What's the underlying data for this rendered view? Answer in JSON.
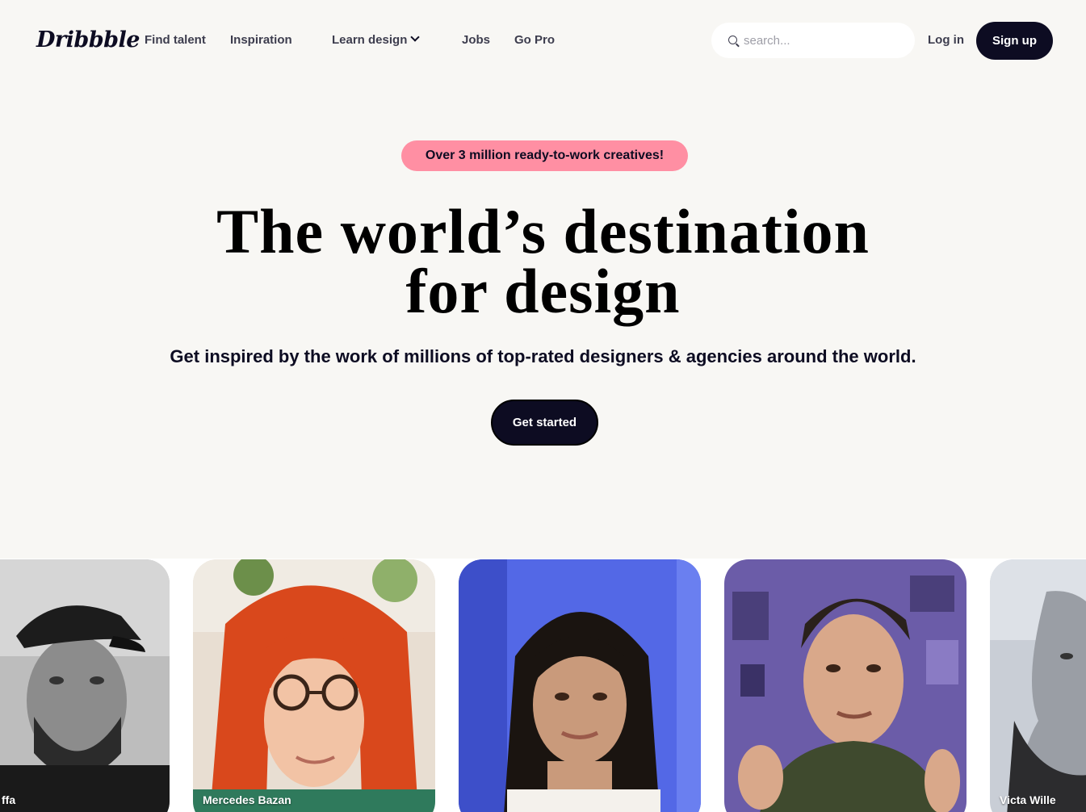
{
  "header": {
    "logo": "Dribbble",
    "nav": [
      {
        "label": "Find talent"
      },
      {
        "label": "Inspiration"
      },
      {
        "label": "Learn design"
      },
      {
        "label": "Jobs"
      },
      {
        "label": "Go Pro"
      }
    ],
    "search_placeholder": "search...",
    "login_label": "Log in",
    "signup_label": "Sign up"
  },
  "hero": {
    "badge": "Over 3 million ready-to-work creatives!",
    "headline_line1": "The world’s destination",
    "headline_line2": "for design",
    "subhead": "Get inspired by the work of millions of top-rated designers & agencies around the world.",
    "cta_label": "Get started"
  },
  "cards": [
    {
      "name": "ffa"
    },
    {
      "name": "Mercedes Bazan"
    },
    {
      "name": ""
    },
    {
      "name": ""
    },
    {
      "name": "Victa Wille"
    }
  ],
  "colors": {
    "background": "#f8f7f4",
    "primary_dark": "#0d0c22",
    "badge_pink": "#ff8fa3",
    "nav_text": "#3d3d4e"
  }
}
